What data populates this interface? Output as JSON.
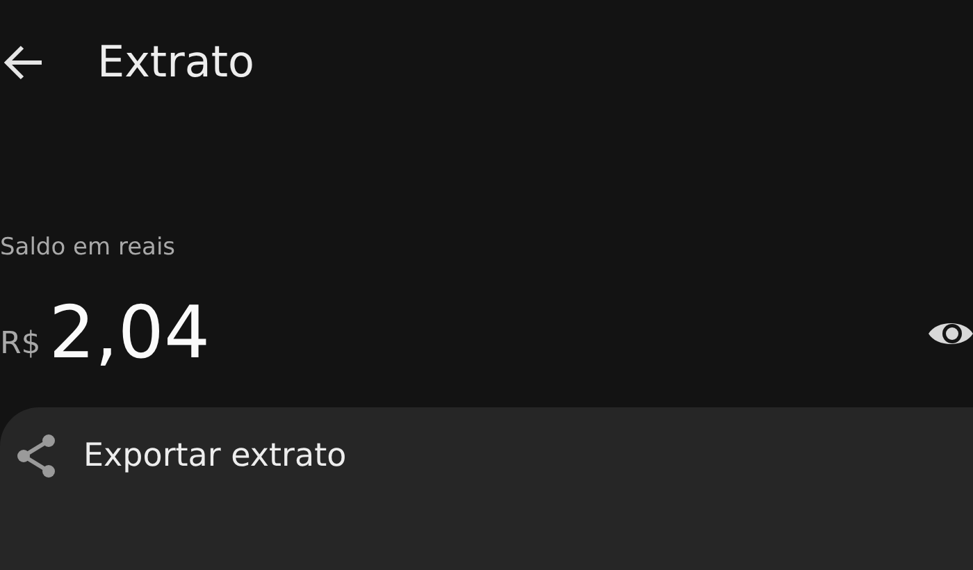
{
  "header": {
    "title": "Extrato"
  },
  "balance": {
    "label": "Saldo em reais",
    "currency": "R$",
    "amount": "2,04",
    "hidden": false
  },
  "actions": [
    {
      "label": "Exportar extrato",
      "kind": "share"
    }
  ]
}
